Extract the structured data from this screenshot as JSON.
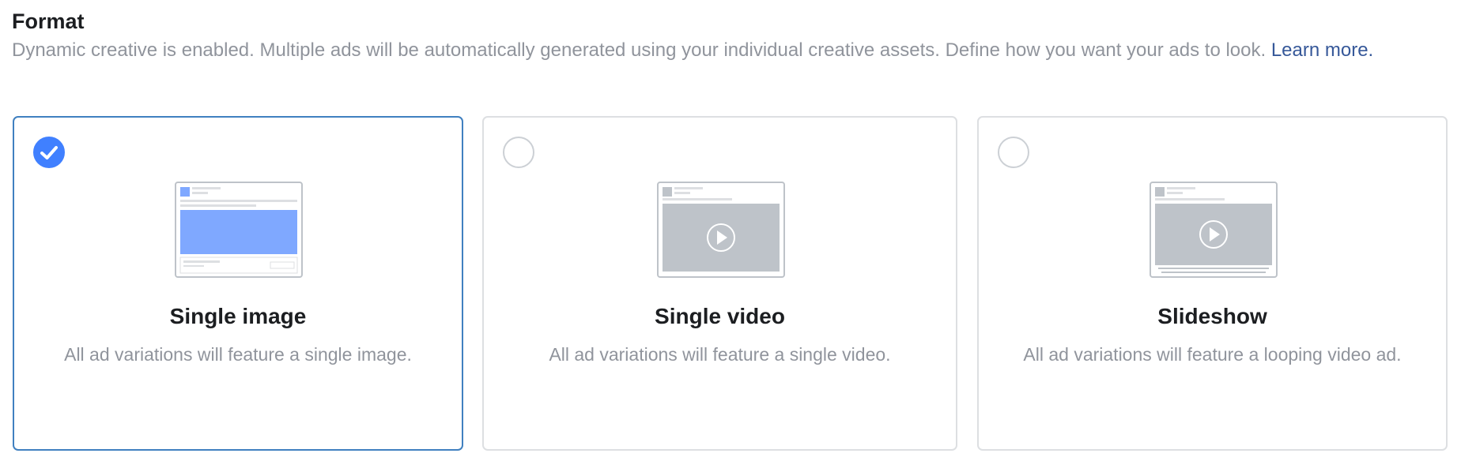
{
  "header": {
    "title": "Format",
    "description": "Dynamic creative is enabled. Multiple ads will be automatically generated using your individual creative assets. Define how you want your ads to look.",
    "learn_more": "Learn more."
  },
  "colors": {
    "accent": "#4080ff",
    "selected_border": "#4080c0",
    "link": "#365899",
    "muted_text": "#90949c",
    "placeholder_gray": "#bec3c9"
  },
  "formats": [
    {
      "title": "Single image",
      "description": "All ad variations will feature a single image.",
      "selected": true,
      "icon": "single-image-preview-icon"
    },
    {
      "title": "Single video",
      "description": "All ad variations will feature a single video.",
      "selected": false,
      "icon": "single-video-preview-icon"
    },
    {
      "title": "Slideshow",
      "description": "All ad variations will feature a looping video ad.",
      "selected": false,
      "icon": "slideshow-preview-icon"
    }
  ]
}
